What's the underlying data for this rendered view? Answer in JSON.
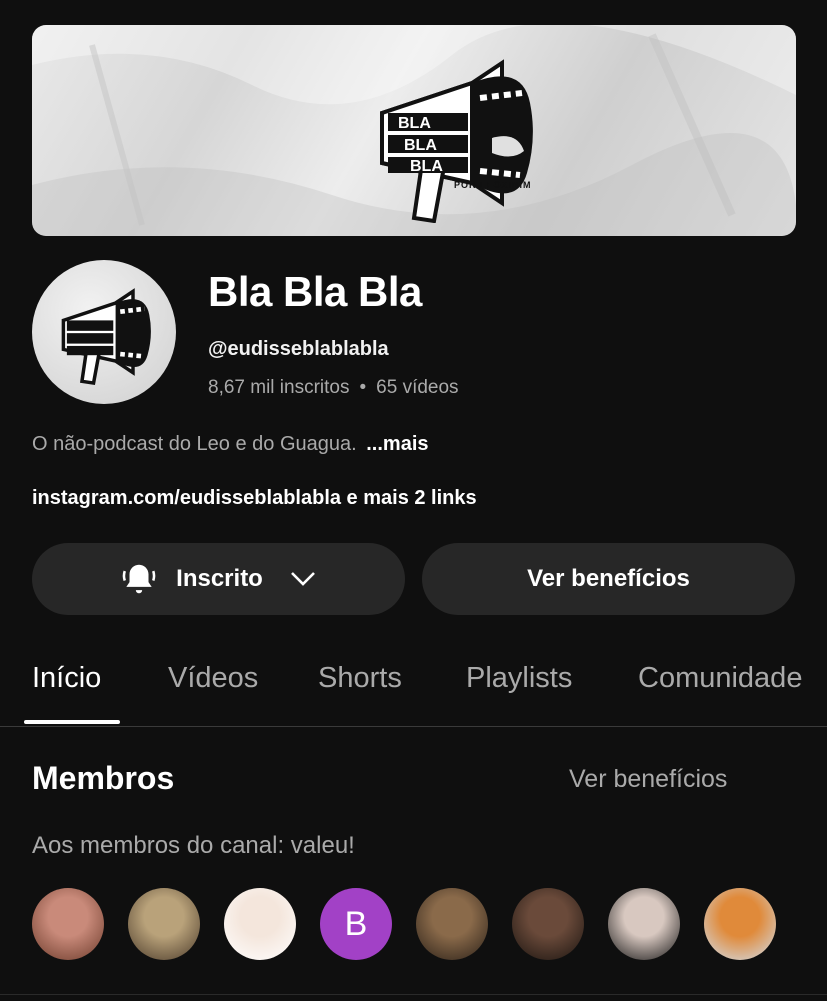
{
  "banner": {
    "logo_text": [
      "BLA",
      "BLA",
      "BLA"
    ],
    "byline": "POR LEOXINIM"
  },
  "channel": {
    "name": "Bla Bla Bla",
    "handle": "@eudisseblablabla",
    "subscribers": "8,67 mil inscritos",
    "separator": "•",
    "videos": "65 vídeos",
    "description": "O não-podcast do Leo e do Guagua.",
    "more": "...mais",
    "links": "instagram.com/eudisseblablabla e mais 2 links"
  },
  "actions": {
    "subscribed_label": "Inscrito",
    "benefits_label": "Ver benefícios"
  },
  "tabs": [
    {
      "label": "Início",
      "active": true
    },
    {
      "label": "Vídeos",
      "active": false
    },
    {
      "label": "Shorts",
      "active": false
    },
    {
      "label": "Playlists",
      "active": false
    },
    {
      "label": "Comunidade",
      "active": false
    }
  ],
  "members": {
    "title": "Membros",
    "link": "Ver benefícios",
    "subtitle": "Aos membros do canal: valeu!",
    "avatars": [
      {
        "type": "photo",
        "colors": [
          "#c98a7a",
          "#6b3a2a"
        ]
      },
      {
        "type": "photo",
        "colors": [
          "#b9a27a",
          "#4a3a2a"
        ]
      },
      {
        "type": "photo",
        "colors": [
          "#f4e6dc",
          "#ffffff"
        ]
      },
      {
        "type": "letter",
        "letter": "B",
        "color": "#a241c6"
      },
      {
        "type": "photo",
        "colors": [
          "#8a6a4a",
          "#2a2018"
        ]
      },
      {
        "type": "photo",
        "colors": [
          "#6a4a3a",
          "#1a1410"
        ]
      },
      {
        "type": "photo",
        "colors": [
          "#d8c8c0",
          "#141414"
        ]
      },
      {
        "type": "photo",
        "colors": [
          "#e08a3a",
          "#d0e0f0"
        ]
      }
    ]
  }
}
